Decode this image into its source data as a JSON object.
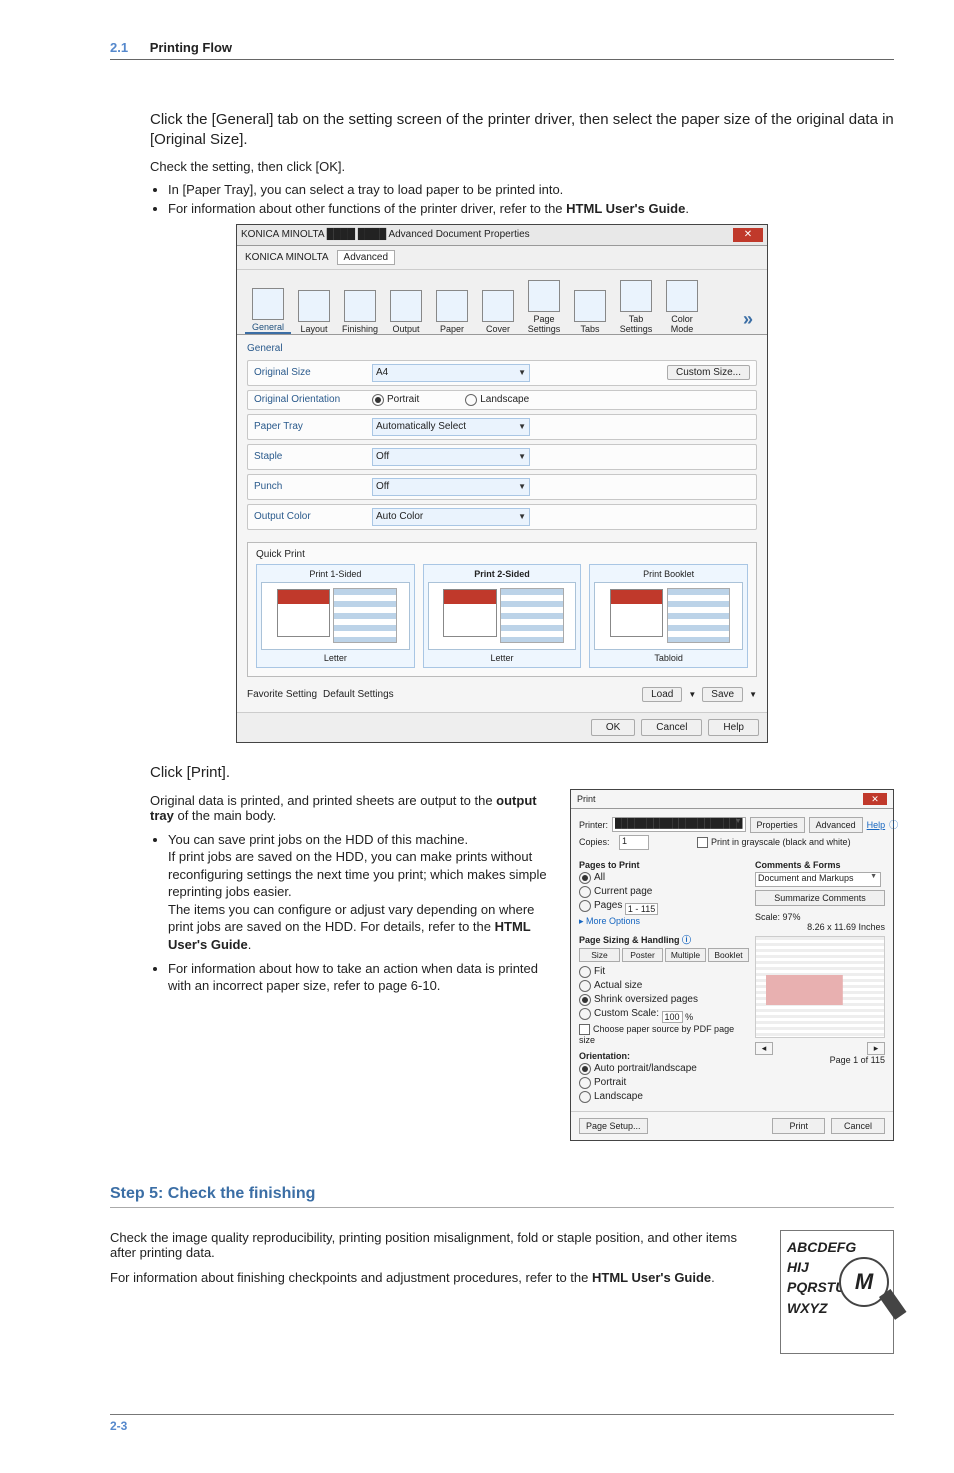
{
  "header": {
    "section_no": "2.1",
    "section_title": "Printing Flow"
  },
  "intro": "Click the [General] tab on the setting screen of the printer driver, then select the paper size of the original data in [Original Size].",
  "check": "Check the setting, then click [OK].",
  "bullets_top": [
    "In [Paper Tray], you can select a tray to load paper to be printed into."
  ],
  "bullets_top_rich": {
    "prefix": "For information about other functions of the printer driver, refer to the ",
    "bold": "HTML User's Guide",
    "suffix": "."
  },
  "dialog1": {
    "titlebar": "KONICA MINOLTA ████ ████ Advanced Document Properties",
    "close": "✕",
    "brand": "KONICA MINOLTA",
    "adv_tab": "Advanced",
    "tabs": [
      "General",
      "Layout",
      "Finishing",
      "Output",
      "Paper",
      "Cover",
      "Page Settings",
      "Tabs",
      "Tab Settings",
      "Color Mode"
    ],
    "tabs_more": "»",
    "section_general": "General",
    "rows": {
      "orig_size": {
        "label": "Original Size",
        "value": "A4",
        "custom": "Custom Size..."
      },
      "orig_orient": {
        "label": "Original Orientation",
        "portrait": "Portrait",
        "landscape": "Landscape"
      },
      "tray": {
        "label": "Paper Tray",
        "value": "Automatically Select"
      },
      "staple": {
        "label": "Staple",
        "value": "Off"
      },
      "punch": {
        "label": "Punch",
        "value": "Off"
      },
      "out_color": {
        "label": "Output Color",
        "value": "Auto Color"
      }
    },
    "quick": {
      "label": "Quick Print",
      "opts": [
        {
          "title": "Print 1-Sided",
          "paper": "Letter"
        },
        {
          "title": "Print 2-Sided",
          "paper": "Letter"
        },
        {
          "title": "Print Booklet",
          "paper": "Tabloid"
        }
      ]
    },
    "fav": {
      "label": "Favorite Setting",
      "value": "Default Settings",
      "load": "Load",
      "save": "Save"
    },
    "footer": {
      "ok": "OK",
      "cancel": "Cancel",
      "help": "Help"
    }
  },
  "click_print": "Click [Print].",
  "after_print_1a": "Original data is printed, and printed sheets are output to the ",
  "after_print_1b": "output tray",
  "after_print_1c": " of the main body.",
  "bullets_mid": {
    "b1a": "You can save print jobs on the HDD of this machine.",
    "b1b": "If print jobs are saved on the HDD, you can make prints without reconfiguring settings the next time you print; which makes simple reprinting jobs easier.",
    "b1c_prefix": "The items you can configure or adjust vary depending on where print jobs are saved on the HDD. For details, refer to the ",
    "b1c_bold": "HTML User's Guide",
    "b1c_suffix": ".",
    "b2": "For information about how to take an action when data is printed with an incorrect paper size, refer to page 6-10."
  },
  "dialog2": {
    "title": "Print",
    "close": "✕",
    "printer_label": "Printer:",
    "printer_value": "████████████████████",
    "properties": "Properties",
    "advanced": "Advanced",
    "help": "Help",
    "copies_label": "Copies:",
    "copies_value": "1",
    "grayscale": "Print in grayscale (black and white)",
    "ptp": {
      "hdr": "Pages to Print",
      "all": "All",
      "current": "Current page",
      "pages": "Pages",
      "pages_value": "1 - 115",
      "more": "More Options"
    },
    "cf": {
      "hdr": "Comments & Forms",
      "value": "Document and Markups",
      "sum": "Summarize Comments"
    },
    "scale_label": "Scale:",
    "scale_value": "97%",
    "paper_dim": "8.26 x 11.69 Inches",
    "psh": {
      "hdr": "Page Sizing & Handling",
      "tabs": [
        "Size",
        "Poster",
        "Multiple",
        "Booklet"
      ],
      "fit": "Fit",
      "actual": "Actual size",
      "shrink": "Shrink oversized pages",
      "custom": "Custom Scale:",
      "custom_val": "100",
      "percent": "%",
      "choose": "Choose paper source by PDF page size"
    },
    "orient": {
      "hdr": "Orientation:",
      "auto": "Auto portrait/landscape",
      "portrait": "Portrait",
      "landscape": "Landscape"
    },
    "pager": "Page 1 of 115",
    "setup": "Page Setup...",
    "print": "Print",
    "cancel": "Cancel"
  },
  "step5": {
    "heading": "Step 5: Check the finishing",
    "p1": "Check the image quality reproducibility, printing position misalignment, fold or staple position, and other items after printing data.",
    "p2_prefix": "For information about finishing checkpoints and adjustment procedures, refer to the ",
    "p2_bold": "HTML User's Guide",
    "p2_suffix": ".",
    "mag": {
      "l1": "ABCDEFG",
      "l2": "HIJ",
      "l3": "PQRSTU",
      "l4": "WXYZ",
      "big": "M"
    }
  },
  "footer_page": "2-3"
}
